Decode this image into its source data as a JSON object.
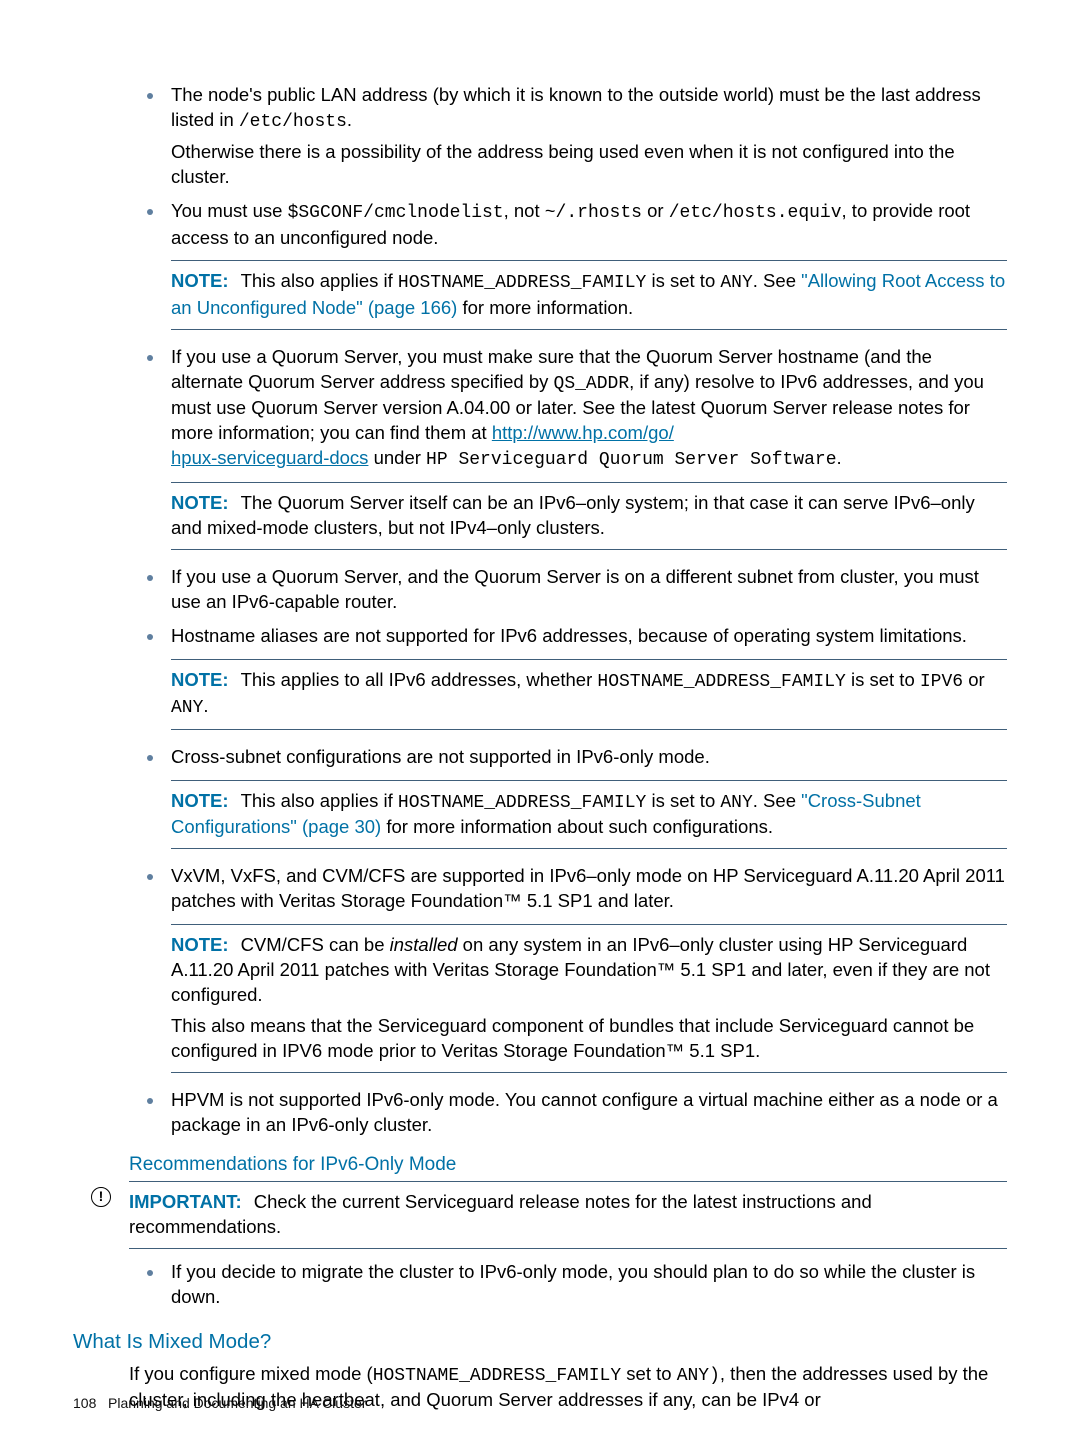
{
  "bullets": {
    "b1": {
      "p1_a": "The node's public LAN address (by which it is known to the outside world) must be the last address listed in ",
      "p1_code": "/etc/hosts",
      "p1_b": ".",
      "p2": "Otherwise there is a possibility of the address being used even when it is not configured into the cluster."
    },
    "b2": {
      "p_a": "You must use ",
      "c1": "$SGCONF/cmclnodelist",
      "p_b": ", not ",
      "c2": "~/.rhosts",
      "p_c": " or ",
      "c3": "/etc/hosts.equiv",
      "p_d": ", to provide root access to an unconfigured node.",
      "note_a": "This also applies if ",
      "note_c1": "HOSTNAME_ADDRESS_FAMILY",
      "note_b": " is set to ",
      "note_c2": "ANY",
      "note_c": ". See ",
      "note_link": "\"Allowing Root Access to an Unconfigured Node\" (page 166)",
      "note_d": " for more information."
    },
    "b3": {
      "p_a": "If you use a Quorum Server, you must make sure that the Quorum Server hostname (and the alternate Quorum Server address specified by ",
      "c1": "QS_ADDR",
      "p_b": ", if any) resolve to IPv6 addresses, and you must use Quorum Server version A.04.00 or later. See the latest Quorum Server release notes for more information; you can find them at ",
      "link1": "http://www.hp.com/go/",
      "link2": "hpux-serviceguard-docs",
      "p_c": " under ",
      "c2": "HP Serviceguard Quorum Server Software",
      "p_d": ".",
      "note": "The Quorum Server itself can be an IPv6–only system; in that case it can serve IPv6–only and mixed-mode clusters, but not IPv4–only clusters."
    },
    "b4": "If you use a Quorum Server, and the Quorum Server is on a different subnet from cluster, you must use an IPv6-capable router.",
    "b5": {
      "p": "Hostname aliases are not supported for IPv6 addresses, because of operating system limitations.",
      "note_a": "This applies to all IPv6 addresses, whether ",
      "note_c1": "HOSTNAME_ADDRESS_FAMILY",
      "note_b": " is set to ",
      "note_c2": "IPV6",
      "note_c": " or ",
      "note_c3": "ANY",
      "note_d": "."
    },
    "b6": {
      "p": "Cross-subnet configurations are not supported in IPv6-only mode.",
      "note_a": "This also applies if ",
      "note_c1": "HOSTNAME_ADDRESS_FAMILY",
      "note_b": " is set to ",
      "note_c2": "ANY",
      "note_c": ". See ",
      "note_link": "\"Cross-Subnet Configurations\" (page 30)",
      "note_d": " for more information about such configurations."
    },
    "b7": {
      "p": "VxVM, VxFS, and CVM/CFS are supported in IPv6–only mode on HP Serviceguard A.11.20 April 2011 patches with Veritas Storage Foundation™ 5.1 SP1 and later.",
      "note_a": "CVM/CFS can be ",
      "note_em": "installed",
      "note_b": " on any system in an IPv6–only cluster using HP Serviceguard A.11.20 April 2011 patches with Veritas Storage Foundation™ 5.1 SP1 and later, even if they are not configured.",
      "note_p2": "This also means that the Serviceguard component of bundles that include Serviceguard cannot be configured in IPV6 mode prior to Veritas Storage Foundation™ 5.1 SP1."
    },
    "b8": "HPVM is not supported IPv6-only mode. You cannot configure a virtual machine either as a node or a package in an IPv6-only cluster."
  },
  "labels": {
    "note": "NOTE:",
    "important": "IMPORTANT:"
  },
  "rec_heading": "Recommendations for IPv6-Only Mode",
  "important_text": "Check the current Serviceguard release notes for the latest instructions and recommendations.",
  "rec_bullet": "If you decide to migrate the cluster to IPv6-only mode, you should plan to do so while the cluster is down.",
  "mixed_heading": "What Is Mixed Mode?",
  "mixed": {
    "a": "If you configure mixed mode (",
    "c1": "HOSTNAME_ADDRESS_FAMILY",
    "b": " set to ",
    "c2": "ANY)",
    "c": ", then the addresses used by the cluster, including the heartbeat, and Quorum Server addresses if any, can be IPv4 or"
  },
  "footer": {
    "page": "108",
    "title": "Planning and Documenting an HA Cluster"
  }
}
